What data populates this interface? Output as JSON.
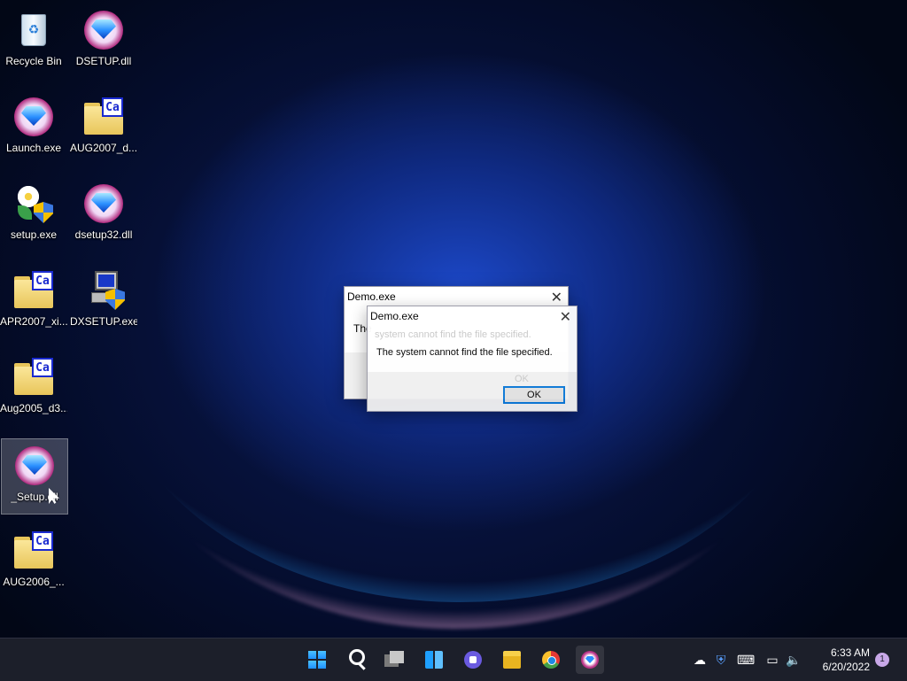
{
  "desktop": {
    "icons": [
      {
        "label": "Recycle Bin",
        "icon": "recycle-bin-icon"
      },
      {
        "label": "DSETUP.dll",
        "icon": "gem-icon"
      },
      {
        "label": "Launch.exe",
        "icon": "gem-icon"
      },
      {
        "label": "AUG2007_d...",
        "icon": "folder-icon"
      },
      {
        "label": "setup.exe",
        "icon": "setup-icon"
      },
      {
        "label": "dsetup32.dll",
        "icon": "gem-icon"
      },
      {
        "label": "APR2007_xi...",
        "icon": "folder-icon"
      },
      {
        "label": "DXSETUP.exe",
        "icon": "dxsetup-icon"
      },
      {
        "label": "Aug2005_d3...",
        "icon": "folder-icon"
      },
      {
        "label": "_Setup.dll",
        "icon": "gem-icon"
      },
      {
        "label": "AUG2006_...",
        "icon": "folder-icon"
      }
    ],
    "folder_badge": "Ca"
  },
  "dialog_back": {
    "title": "Demo.exe",
    "message_prefix": "The",
    "ghost_message": "system cannot find the file specified.",
    "ghost_ok": "OK"
  },
  "dialog_front": {
    "title": "Demo.exe",
    "message": "The system cannot find the file specified.",
    "ok_label": "OK"
  },
  "taskbar": {
    "apps": [
      "start-icon",
      "search-icon",
      "task-view-icon",
      "widgets-icon",
      "chat-icon",
      "file-explorer-icon",
      "chrome-icon",
      "gem-app-icon"
    ],
    "clock_time": "6:33 AM",
    "clock_date": "6/20/2022",
    "notification_count": "1"
  },
  "colors": {
    "accent": "#0b78d7",
    "taskbar_bg": "#1c1f2a"
  }
}
